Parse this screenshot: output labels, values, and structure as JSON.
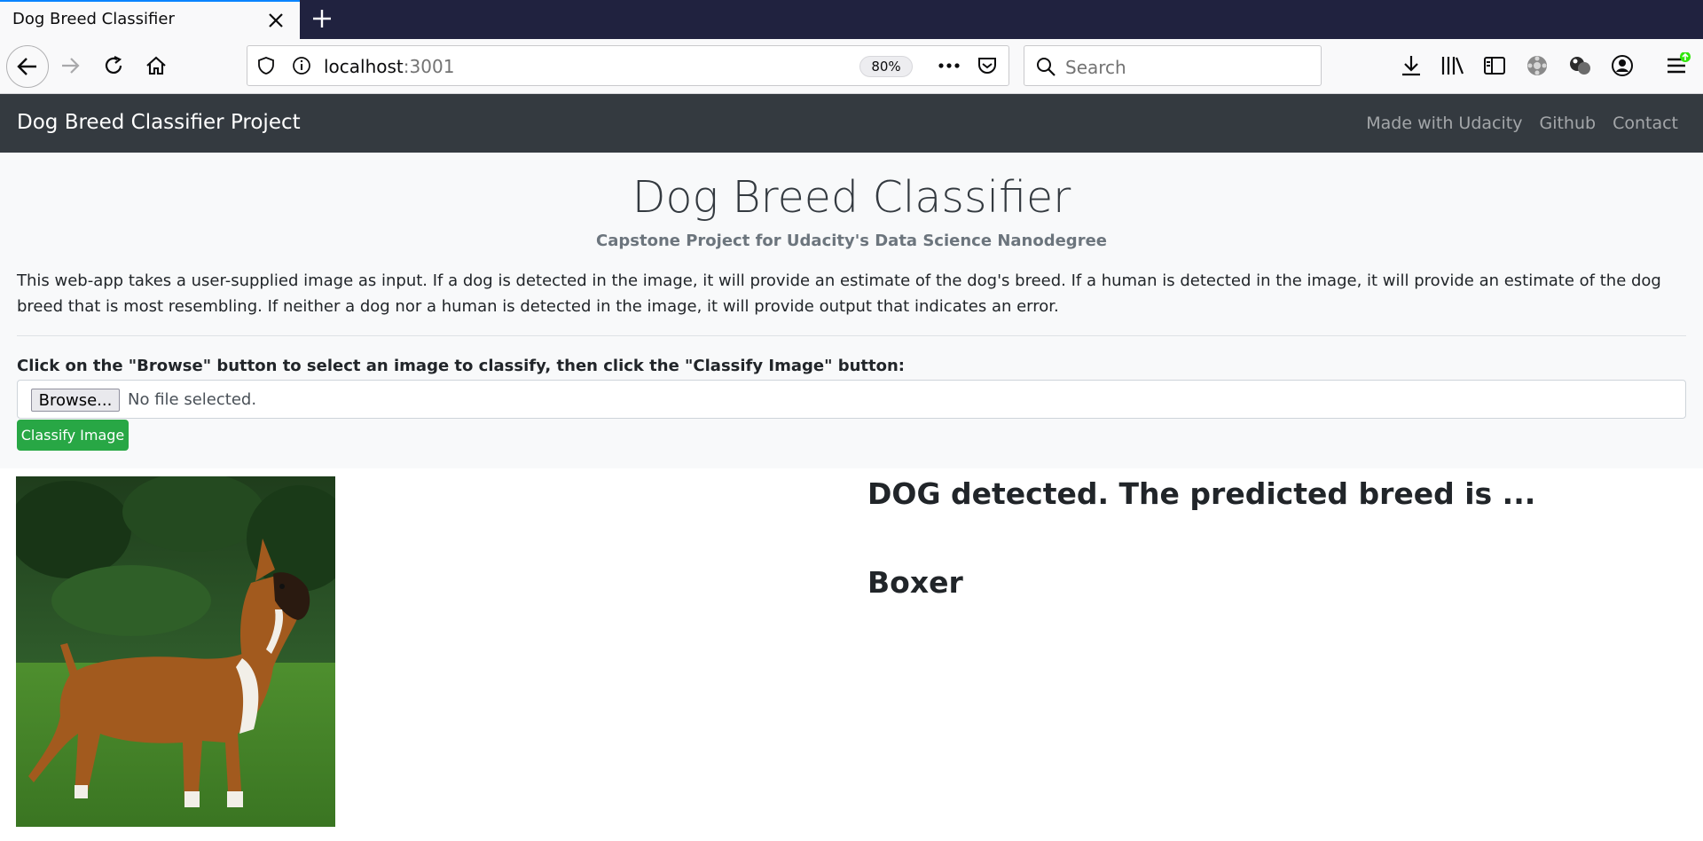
{
  "browser": {
    "tab_title": "Dog Breed Classifier",
    "url_host": "localhost",
    "url_port": ":3001",
    "zoom": "80%",
    "search_placeholder": "Search"
  },
  "navbar": {
    "brand": "Dog Breed Classifier Project",
    "links": [
      "Made with Udacity",
      "Github",
      "Contact"
    ]
  },
  "header": {
    "title": "Dog Breed Classifier",
    "subtitle": "Capstone Project for Udacity's Data Science Nanodegree",
    "description": "This web-app takes a user-supplied image as input. If a dog is detected in the image, it will provide an estimate of the dog's breed. If a human is detected in the image, it will provide an estimate of the dog breed that is most resembling. If neither a dog nor a human is detected in the image, it will provide output that indicates an error."
  },
  "form": {
    "instruction": "Click on the \"Browse\" button to select an image to classify, then click the \"Classify Image\" button:",
    "browse_label": "Browse...",
    "file_status": "No file selected.",
    "classify_label": "Classify Image"
  },
  "result": {
    "heading": "DOG detected. The predicted breed is ...",
    "breed": "Boxer"
  },
  "colors": {
    "navbar_bg": "#343a40",
    "jumbotron_bg": "#f8f9fa",
    "classify_button": "#28a745",
    "tabbar_bg": "#20223f"
  },
  "icons": [
    "close-icon",
    "plus-icon",
    "back-arrow-icon",
    "forward-arrow-icon",
    "reload-icon",
    "home-icon",
    "shield-icon",
    "info-icon",
    "more-icon",
    "pocket-icon",
    "search-icon",
    "download-icon",
    "library-icon",
    "sidebar-icon",
    "extension-icon",
    "account-icon",
    "menu-icon"
  ]
}
